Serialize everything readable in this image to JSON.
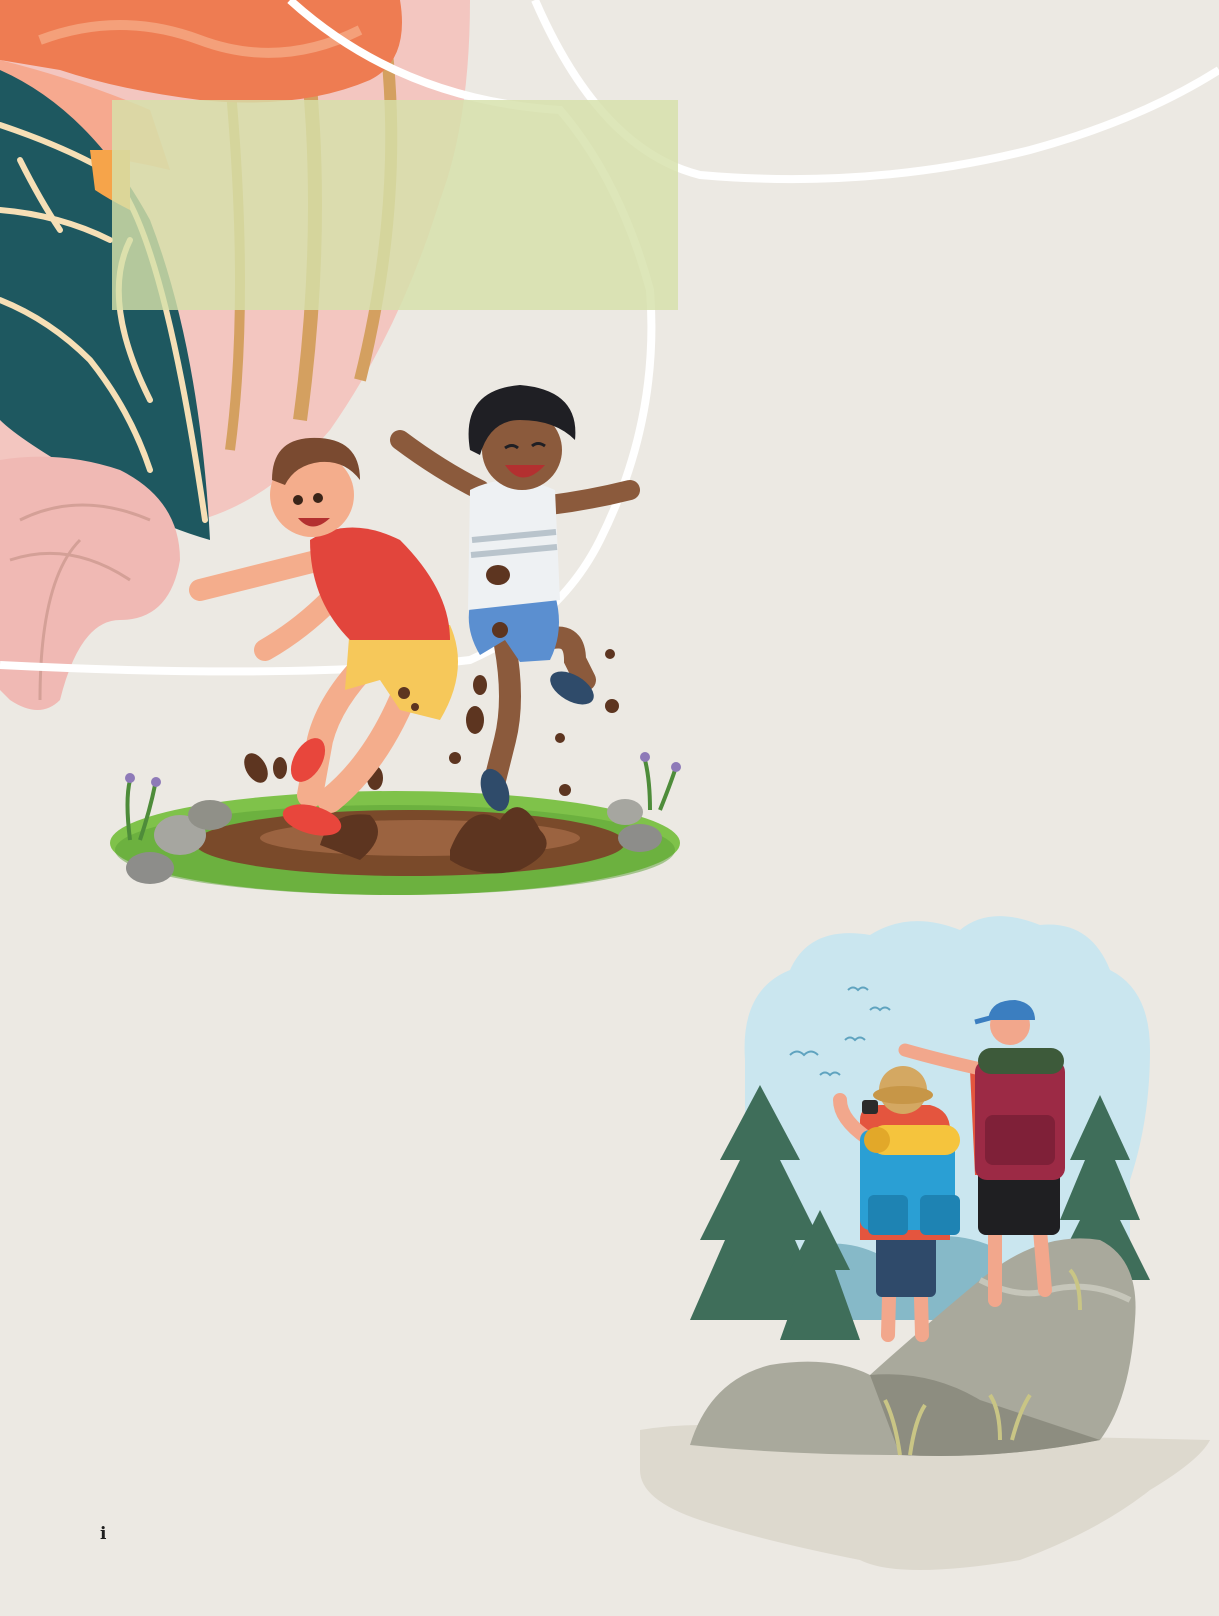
{
  "page": {
    "background_color": "#ece9e3",
    "title_box_color": "#d5e0aa",
    "page_mark": "i"
  },
  "illustrations": {
    "decor": "tropical-leaves-corner-decoration",
    "kids": "two-children-jumping-in-mud-puddle",
    "hikers": "two-hikers-on-rock-looking-at-view"
  }
}
